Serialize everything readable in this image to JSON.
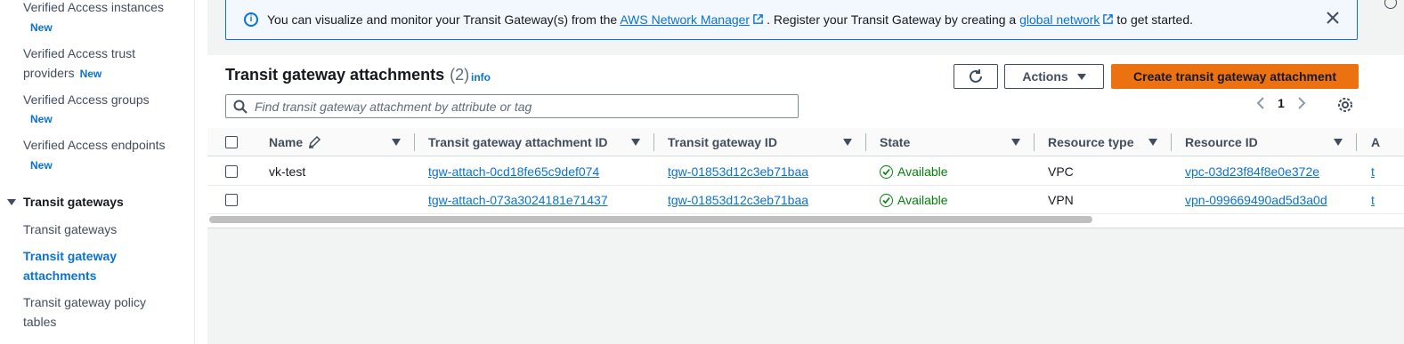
{
  "sidebar": {
    "items": [
      {
        "label": "Verified Access instances",
        "badge": "New"
      },
      {
        "label": "Verified Access trust providers",
        "badge": "New"
      },
      {
        "label": "Verified Access groups",
        "badge": "New"
      },
      {
        "label": "Verified Access endpoints",
        "badge": "New"
      }
    ],
    "section": {
      "label": "Transit gateways",
      "items": [
        {
          "label": "Transit gateways",
          "active": false
        },
        {
          "label": "Transit gateway attachments",
          "active": true
        },
        {
          "label": "Transit gateway policy tables",
          "active": false
        }
      ]
    }
  },
  "banner": {
    "text_before": "You can visualize and monitor your Transit Gateway(s) from the",
    "link1": "AWS Network Manager",
    "text_middle": ". Register your Transit Gateway by creating a",
    "link2": "global network",
    "text_after": "to get started."
  },
  "header": {
    "title": "Transit gateway attachments",
    "count": "(2)",
    "info": "info"
  },
  "toolbar": {
    "actions_label": "Actions",
    "create_label": "Create transit gateway attachment"
  },
  "search": {
    "placeholder": "Find transit gateway attachment by attribute or tag"
  },
  "pagination": {
    "current_page": "1"
  },
  "table": {
    "columns": [
      "Name",
      "Transit gateway attachment ID",
      "Transit gateway ID",
      "State",
      "Resource type",
      "Resource ID",
      "A"
    ],
    "rows": [
      {
        "name": "vk-test",
        "attachment_id": "tgw-attach-0cd18fe65c9def074",
        "tgw_id": "tgw-01853d12c3eb71baa",
        "state": "Available",
        "resource_type": "VPC",
        "resource_id": "vpc-03d23f84f8e0e372e",
        "truncated": "t"
      },
      {
        "name": "",
        "attachment_id": "tgw-attach-073a3024181e71437",
        "tgw_id": "tgw-01853d12c3eb71baa",
        "state": "Available",
        "resource_type": "VPN",
        "resource_id": "vpn-099669490ad5d3a0d",
        "truncated": "t"
      }
    ]
  },
  "colors": {
    "link": "#0972d3",
    "primary_button": "#ec7211",
    "success": "#037f0c"
  }
}
